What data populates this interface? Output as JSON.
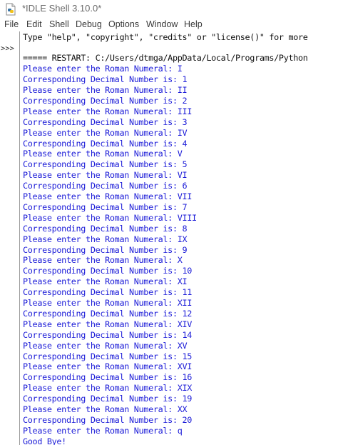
{
  "window": {
    "title": "*IDLE Shell 3.10.0*"
  },
  "menu": [
    "File",
    "Edit",
    "Shell",
    "Debug",
    "Options",
    "Window",
    "Help"
  ],
  "prompt": ">>>",
  "lines": [
    {
      "text": "Type \"help\", \"copyright\", \"credits\" or \"license()\" for more",
      "kind": "sys"
    },
    {
      "text": "",
      "kind": "sys"
    },
    {
      "text": "===== RESTART: C:/Users/dtmga/AppData/Local/Programs/Python",
      "kind": "sys"
    },
    {
      "text": "Please enter the Roman Numeral: I",
      "kind": "out"
    },
    {
      "text": "Corresponding Decimal Number is: 1",
      "kind": "out"
    },
    {
      "text": "Please enter the Roman Numeral: II",
      "kind": "out"
    },
    {
      "text": "Corresponding Decimal Number is: 2",
      "kind": "out"
    },
    {
      "text": "Please enter the Roman Numeral: III",
      "kind": "out"
    },
    {
      "text": "Corresponding Decimal Number is: 3",
      "kind": "out"
    },
    {
      "text": "Please enter the Roman Numeral: IV",
      "kind": "out"
    },
    {
      "text": "Corresponding Decimal Number is: 4",
      "kind": "out"
    },
    {
      "text": "Please enter the Roman Numeral: V",
      "kind": "out"
    },
    {
      "text": "Corresponding Decimal Number is: 5",
      "kind": "out"
    },
    {
      "text": "Please enter the Roman Numeral: VI",
      "kind": "out"
    },
    {
      "text": "Corresponding Decimal Number is: 6",
      "kind": "out"
    },
    {
      "text": "Please enter the Roman Numeral: VII",
      "kind": "out"
    },
    {
      "text": "Corresponding Decimal Number is: 7",
      "kind": "out"
    },
    {
      "text": "Please enter the Roman Numeral: VIII",
      "kind": "out"
    },
    {
      "text": "Corresponding Decimal Number is: 8",
      "kind": "out"
    },
    {
      "text": "Please enter the Roman Numeral: IX",
      "kind": "out"
    },
    {
      "text": "Corresponding Decimal Number is: 9",
      "kind": "out"
    },
    {
      "text": "Please enter the Roman Numeral: X",
      "kind": "out"
    },
    {
      "text": "Corresponding Decimal Number is: 10",
      "kind": "out"
    },
    {
      "text": "Please enter the Roman Numeral: XI",
      "kind": "out"
    },
    {
      "text": "Corresponding Decimal Number is: 11",
      "kind": "out"
    },
    {
      "text": "Please enter the Roman Numeral: XII",
      "kind": "out"
    },
    {
      "text": "Corresponding Decimal Number is: 12",
      "kind": "out"
    },
    {
      "text": "Please enter the Roman Numeral: XIV",
      "kind": "out"
    },
    {
      "text": "Corresponding Decimal Number is: 14",
      "kind": "out"
    },
    {
      "text": "Please enter the Roman Numeral: XV",
      "kind": "out"
    },
    {
      "text": "Corresponding Decimal Number is: 15",
      "kind": "out"
    },
    {
      "text": "Please enter the Roman Numeral: XVI",
      "kind": "out"
    },
    {
      "text": "Corresponding Decimal Number is: 16",
      "kind": "out"
    },
    {
      "text": "Please enter the Roman Numeral: XIX",
      "kind": "out"
    },
    {
      "text": "Corresponding Decimal Number is: 19",
      "kind": "out"
    },
    {
      "text": "Please enter the Roman Numeral: XX",
      "kind": "out"
    },
    {
      "text": "Corresponding Decimal Number is: 20",
      "kind": "out"
    },
    {
      "text": "Please enter the Roman Numeral: q",
      "kind": "out"
    },
    {
      "text": "Good Bye!",
      "kind": "out"
    }
  ],
  "colors": {
    "output": "#1c1cd8",
    "system": "#111111",
    "divider": "#9c9c9c"
  },
  "icons": {
    "app": "idle-python-icon"
  }
}
